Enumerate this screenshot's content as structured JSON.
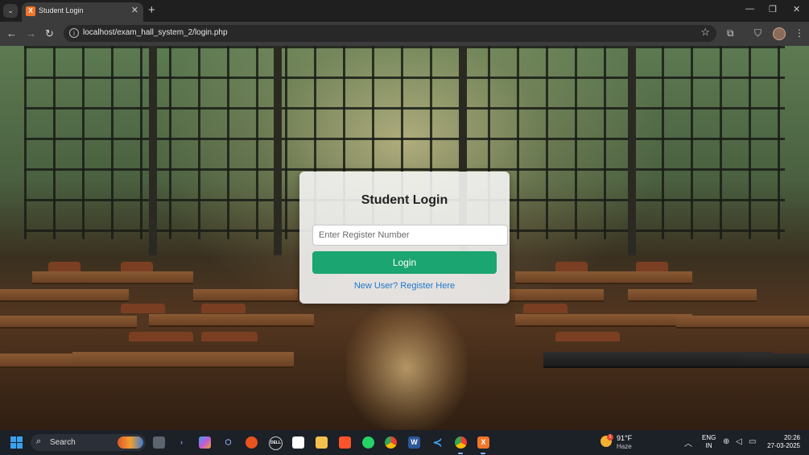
{
  "browser": {
    "tab_title": "Student Login",
    "url": "localhost/exam_hall_system_2/login.php"
  },
  "login": {
    "title": "Student Login",
    "register_number_placeholder": "Enter Register Number",
    "login_button": "Login",
    "register_link": "New User? Register Here"
  },
  "taskbar": {
    "search_label": "Search",
    "weather_badge": "1",
    "weather_temp": "91°F",
    "weather_desc": "Haze",
    "lang_line1": "ENG",
    "lang_line2": "IN",
    "time": "20:26",
    "date": "27-03-2025",
    "icons": [
      "task-view-icon",
      "terminal-icon",
      "copilot-icon",
      "cube-icon",
      "firefox-icon",
      "dell-icon",
      "store-icon",
      "file-explorer-icon",
      "brave-icon",
      "whatsapp-icon",
      "chrome-icon",
      "word-icon",
      "vscode-icon",
      "chrome-profile-icon",
      "xampp-icon"
    ]
  },
  "colors": {
    "login_button": "#1ba570",
    "register_link": "#1f78c8",
    "tab_favicon": "#f0762b"
  }
}
